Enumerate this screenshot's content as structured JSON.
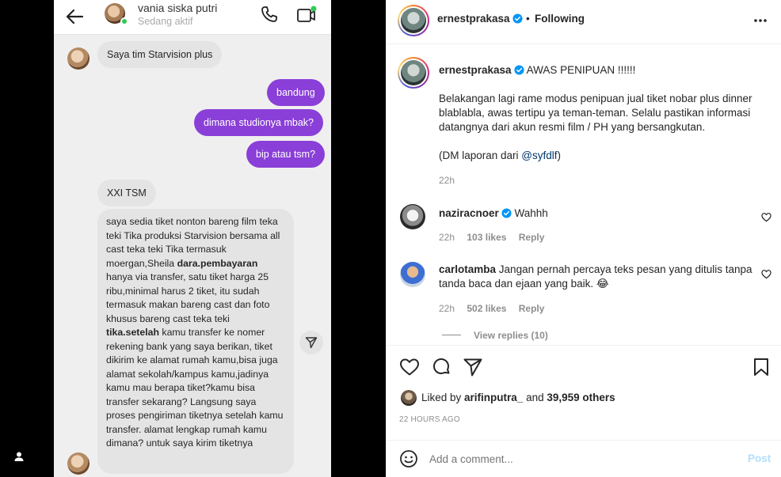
{
  "chat": {
    "contact_name": "vania siska putri",
    "contact_status": "Sedang aktif",
    "messages": [
      {
        "side": "in",
        "text": "Saya tim Starvision plus"
      },
      {
        "side": "out",
        "text": "bandung"
      },
      {
        "side": "out",
        "text": "dimana studionya mbak?"
      },
      {
        "side": "out",
        "text": "bip atau tsm?"
      },
      {
        "side": "in",
        "text": "XXI TSM"
      }
    ],
    "long_message": {
      "part1": "saya sedia tiket nonton bareng film teka teki Tika produksi Starvision bersama all cast teka teki Tika termasuk moergan,Sheila ",
      "bold1": "dara.pembayaran",
      "part2": " hanya via transfer, satu tiket harga 25 ribu,minimal harus 2 tiket, itu sudah termasuk makan bareng cast dan foto khusus bareng cast teka teki ",
      "bold2": "tika.setelah",
      "part3": " kamu transfer ke nomer rekening bank yang saya berikan, tiket dikirim ke alamat rumah kamu,bisa juga alamat sekolah/kampus kamu,jadinya kamu mau berapa tiket?kamu bisa transfer sekarang? Langsung saya proses pengiriman tiketnya setelah kamu transfer. alamat lengkap rumah kamu dimana? untuk saya kirim tiketnya"
    }
  },
  "post": {
    "author": "ernestprakasa",
    "follow_state": "Following",
    "caption_title": "AWAS PENIPUAN !!!!!!",
    "caption_body": "Belakangan lagi rame modus penipuan jual tiket nobar plus dinner blablabla, awas tertipu ya teman-teman. Selalu pastikan informasi datangnya dari akun resmi film / PH yang bersangkutan.",
    "caption_dm_prefix": "(DM laporan dari ",
    "caption_dm_mention": "@syfdlf",
    "caption_dm_suffix": ")",
    "caption_time": "22h",
    "comments": [
      {
        "user": "naziracnoer",
        "verified": true,
        "text": "Wahhh",
        "time": "22h",
        "likes": "103 likes",
        "reply": "Reply"
      },
      {
        "user": "carlotamba",
        "verified": false,
        "text": "Jangan pernah percaya teks pesan yang ditulis tanpa tanda baca dan ejaan yang baik. 😂",
        "time": "22h",
        "likes": "502 likes",
        "reply": "Reply",
        "view_replies": "View replies (10)"
      }
    ],
    "liked_by_prefix": "Liked by ",
    "liked_by_user": "arifinputra_",
    "liked_by_and": " and ",
    "liked_by_others": "39,959 others",
    "posted_ago": "22 HOURS AGO",
    "comment_placeholder": "Add a comment...",
    "post_button": "Post"
  },
  "colors": {
    "outgoing_bubble": "#8a3fd8",
    "incoming_bubble": "#e5e4e4",
    "verified": "#0095f6",
    "link": "#00376b",
    "post_button_disabled": "#b2dffc"
  }
}
